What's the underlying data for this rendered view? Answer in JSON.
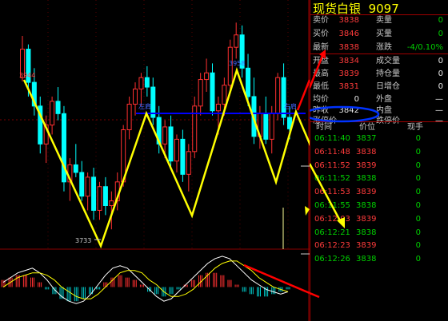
{
  "chart_data": {
    "type": "candlestick",
    "title": "",
    "annotations": {
      "high_left": "3944",
      "low": "3733",
      "peak": "3958",
      "left_shoulder": "左肩",
      "right_shoulder": "右肩"
    },
    "main_ylim": [
      3725,
      3965
    ],
    "osc_ylim": [
      -12,
      14
    ],
    "candles": [
      [
        3900,
        3944,
        3896,
        3930
      ],
      [
        3930,
        3935,
        3880,
        3895
      ],
      [
        3895,
        3910,
        3860,
        3870
      ],
      [
        3870,
        3880,
        3820,
        3830
      ],
      [
        3830,
        3860,
        3810,
        3850
      ],
      [
        3850,
        3880,
        3840,
        3875
      ],
      [
        3875,
        3890,
        3855,
        3862
      ],
      [
        3862,
        3870,
        3780,
        3790
      ],
      [
        3790,
        3815,
        3770,
        3808
      ],
      [
        3808,
        3830,
        3795,
        3800
      ],
      [
        3800,
        3812,
        3770,
        3775
      ],
      [
        3775,
        3800,
        3760,
        3795
      ],
      [
        3795,
        3805,
        3750,
        3760
      ],
      [
        3760,
        3790,
        3750,
        3785
      ],
      [
        3785,
        3795,
        3755,
        3765
      ],
      [
        3765,
        3780,
        3740,
        3770
      ],
      [
        3770,
        3800,
        3760,
        3790
      ],
      [
        3790,
        3850,
        3785,
        3845
      ],
      [
        3845,
        3880,
        3835,
        3872
      ],
      [
        3872,
        3895,
        3860,
        3888
      ],
      [
        3888,
        3905,
        3870,
        3900
      ],
      [
        3900,
        3912,
        3880,
        3890
      ],
      [
        3890,
        3900,
        3850,
        3858
      ],
      [
        3858,
        3870,
        3820,
        3830
      ],
      [
        3830,
        3855,
        3815,
        3848
      ],
      [
        3848,
        3860,
        3805,
        3812
      ],
      [
        3812,
        3840,
        3800,
        3835
      ],
      [
        3835,
        3845,
        3790,
        3798
      ],
      [
        3798,
        3830,
        3780,
        3822
      ],
      [
        3822,
        3880,
        3815,
        3870
      ],
      [
        3870,
        3905,
        3860,
        3898
      ],
      [
        3898,
        3920,
        3885,
        3905
      ],
      [
        3905,
        3915,
        3860,
        3865
      ],
      [
        3865,
        3880,
        3840,
        3872
      ],
      [
        3872,
        3900,
        3860,
        3892
      ],
      [
        3892,
        3940,
        3885,
        3932
      ],
      [
        3932,
        3958,
        3920,
        3945
      ],
      [
        3945,
        3955,
        3900,
        3910
      ],
      [
        3910,
        3925,
        3870,
        3880
      ],
      [
        3880,
        3900,
        3830,
        3838
      ],
      [
        3838,
        3870,
        3825,
        3862
      ],
      [
        3862,
        3880,
        3830,
        3835
      ],
      [
        3835,
        3870,
        3820,
        3862
      ],
      [
        3862,
        3905,
        3855,
        3900
      ],
      [
        3900,
        3915,
        3850,
        3858
      ],
      [
        3858,
        3870,
        3835,
        3846
      ]
    ],
    "quote_volume_bars": [
      14,
      22,
      30,
      18,
      12,
      40,
      9,
      26,
      15,
      10,
      45,
      20,
      8
    ],
    "osc_line_fast": [
      2,
      4,
      6,
      7,
      8,
      6,
      3,
      -1,
      -4,
      -6,
      -7,
      -6,
      -3,
      1,
      5,
      8,
      9,
      8,
      5,
      2,
      -1,
      -4,
      -6,
      -5,
      -2,
      1,
      4,
      7,
      10,
      12,
      13,
      12,
      9,
      6,
      3,
      1,
      -1,
      -2,
      -3,
      -2
    ],
    "osc_line_slow": [
      0,
      2,
      4,
      5,
      6,
      6,
      5,
      3,
      0,
      -2,
      -4,
      -5,
      -5,
      -3,
      0,
      3,
      6,
      7,
      7,
      6,
      3,
      1,
      -2,
      -4,
      -4,
      -3,
      -1,
      2,
      5,
      8,
      10,
      11,
      11,
      9,
      7,
      4,
      2,
      0,
      -1,
      -2
    ],
    "histogram": [
      3,
      4,
      5,
      5,
      4,
      2,
      -1,
      -3,
      -5,
      -6,
      -6,
      -5,
      -3,
      -1,
      2,
      4,
      5,
      4,
      3,
      1,
      -2,
      -3,
      -4,
      -3,
      -1,
      1,
      3,
      5,
      6,
      6,
      5,
      3,
      1,
      -2,
      -3,
      -4,
      -4,
      -3,
      -2,
      -1
    ]
  },
  "overlay": {
    "neckline_color": "#0000ff",
    "pattern_color": "#ffff00",
    "arrow_color": "#ff0000",
    "ellipse_color": "#0033ff"
  },
  "quote_panel": {
    "title": "现货白银",
    "code": "9097",
    "rows": [
      {
        "l1": "卖价",
        "v1": "3838",
        "c1": "up",
        "l2": "卖量",
        "v2": "0",
        "c2": "down"
      },
      {
        "l1": "买价",
        "v1": "3846",
        "c1": "up",
        "l2": "买量",
        "v2": "0",
        "c2": "down"
      },
      {
        "l1": "最新",
        "v1": "3838",
        "c1": "up",
        "l2": "涨跌",
        "v2": "-4/0.10%",
        "c2": "down"
      },
      {
        "l1": "开盘",
        "v1": "3834",
        "c1": "up",
        "l2": "成交量",
        "v2": "0",
        "c2": "white"
      },
      {
        "l1": "最高",
        "v1": "3839",
        "c1": "up",
        "l2": "持仓量",
        "v2": "0",
        "c2": "white"
      },
      {
        "l1": "最低",
        "v1": "3831",
        "c1": "up",
        "l2": "日增仓",
        "v2": "0",
        "c2": "white"
      },
      {
        "l1": "均价",
        "v1": "0",
        "c1": "white",
        "l2": "外盘",
        "v2": "—",
        "c2": "white"
      },
      {
        "l1": "昨收",
        "v1": "3842",
        "c1": "white",
        "l2": "内盘",
        "v2": "—",
        "c2": "white"
      },
      {
        "l1": "涨停价",
        "v1": "—",
        "c1": "white",
        "l2": "跌停价",
        "v2": "—",
        "c2": "white"
      }
    ],
    "trades_header": {
      "time": "时间",
      "price": "价位",
      "vol": "现手"
    },
    "trades": [
      {
        "time": "06:11:40",
        "price": "3837",
        "pc": "down",
        "vol": "0"
      },
      {
        "time": "06:11:48",
        "price": "3838",
        "pc": "up",
        "vol": "0"
      },
      {
        "time": "06:11:52",
        "price": "3839",
        "pc": "up",
        "vol": "0"
      },
      {
        "time": "06:11:52",
        "price": "3838",
        "pc": "down",
        "vol": "0"
      },
      {
        "time": "06:11:53",
        "price": "3839",
        "pc": "up",
        "vol": "0"
      },
      {
        "time": "06:11:55",
        "price": "3838",
        "pc": "down",
        "vol": "0"
      },
      {
        "time": "06:12:03",
        "price": "3839",
        "pc": "up",
        "vol": "0"
      },
      {
        "time": "06:12:21",
        "price": "3838",
        "pc": "down",
        "vol": "0"
      },
      {
        "time": "06:12:23",
        "price": "3839",
        "pc": "up",
        "vol": "0"
      },
      {
        "time": "06:12:26",
        "price": "3838",
        "pc": "down",
        "vol": "0"
      }
    ]
  }
}
